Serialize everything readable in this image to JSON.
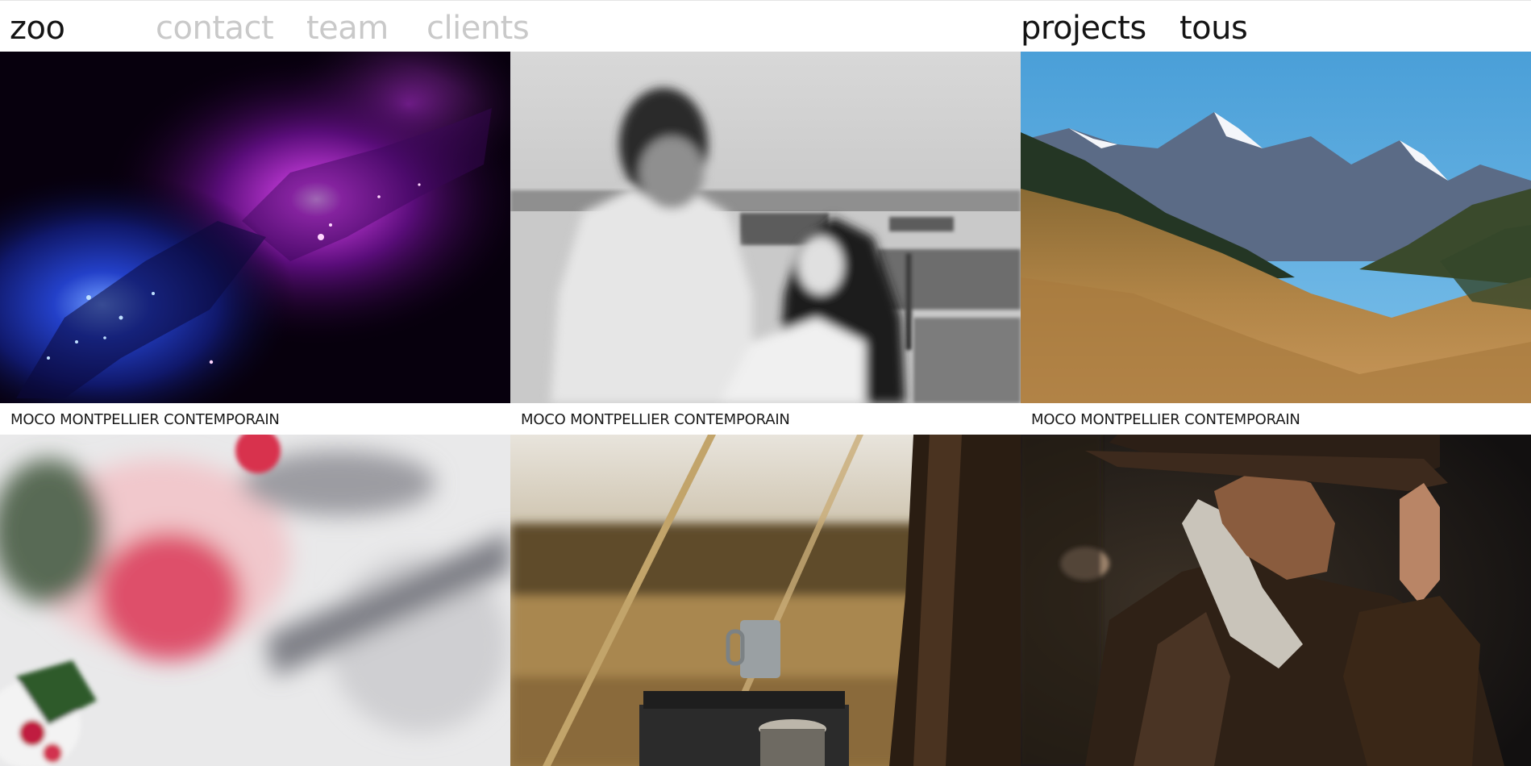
{
  "header": {
    "nav": [
      {
        "label": "zoo"
      },
      {
        "label": "contact"
      },
      {
        "label": "team"
      },
      {
        "label": "clients"
      },
      {
        "label": "projects"
      },
      {
        "label": "tous"
      }
    ]
  },
  "projects": [
    {
      "caption": "MOCO MONTPELLIER CONTEMPORAIN"
    },
    {
      "caption": "MOCO MONTPELLIER CONTEMPORAIN"
    },
    {
      "caption": "MOCO MONTPELLIER CONTEMPORAIN"
    }
  ]
}
